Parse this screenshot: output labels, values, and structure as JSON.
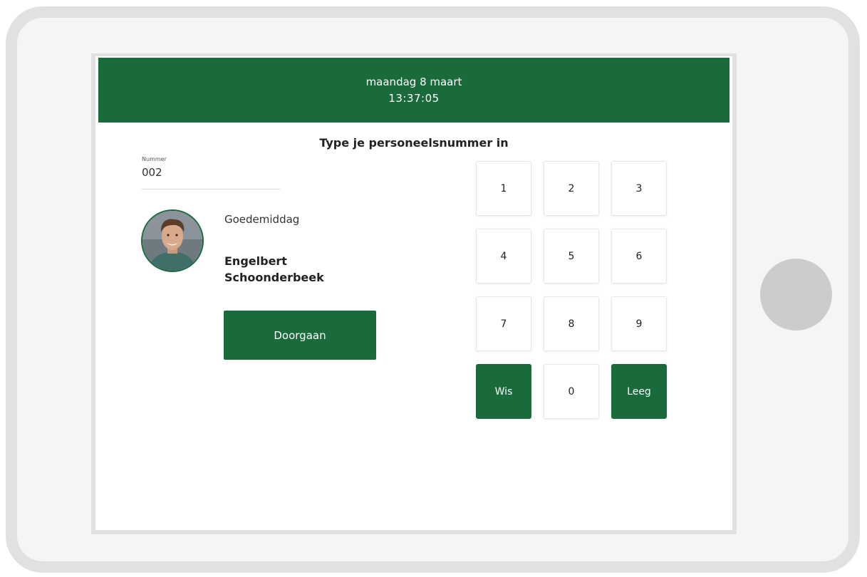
{
  "header": {
    "date": "maandag 8 maart",
    "time": "13:37:05"
  },
  "prompt": "Type je personeelsnummer in",
  "number_field": {
    "label": "Nummer",
    "value": "002"
  },
  "user": {
    "greeting": "Goedemiddag",
    "name": "Engelbert Schoonderbeek"
  },
  "continue_label": "Doorgaan",
  "keypad": {
    "k1": "1",
    "k2": "2",
    "k3": "3",
    "k4": "4",
    "k5": "5",
    "k6": "6",
    "k7": "7",
    "k8": "8",
    "k9": "9",
    "clear": "Wis",
    "k0": "0",
    "empty": "Leeg"
  },
  "colors": {
    "brand_green": "#196b3b",
    "frame_grey": "#e1e1e1",
    "home_button": "#cccccc"
  },
  "icons": {
    "avatar": "user-photo"
  }
}
